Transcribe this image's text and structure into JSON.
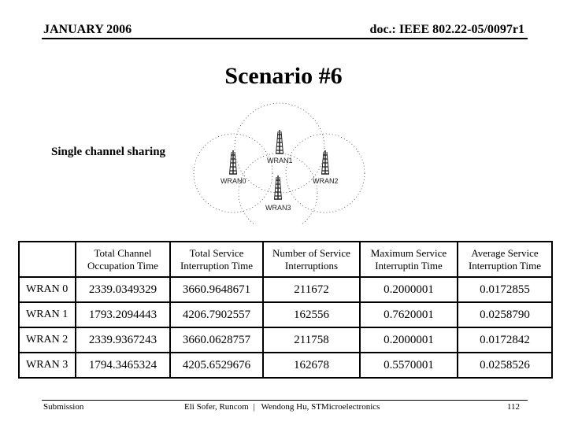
{
  "header": {
    "date": "JANUARY 2006",
    "doc_id": "doc.: IEEE 802.22-05/0097r1"
  },
  "title": "Scenario #6",
  "subtitle": "Single channel sharing",
  "diagram": {
    "stations": [
      {
        "label": "WRAN0",
        "icon": "tower-icon"
      },
      {
        "label": "WRAN1",
        "icon": "tower-icon"
      },
      {
        "label": "WRAN2",
        "icon": "tower-icon"
      },
      {
        "label": "WRAN3",
        "icon": "tower-icon"
      }
    ]
  },
  "table": {
    "headers": [
      "",
      "Total Channel Occupation Time",
      "Total Service Interruption Time",
      "Number of Service Interruptions",
      "Maximum Service Interruptin Time",
      "Average Service Interruption Time"
    ],
    "header_lines": [
      [
        "",
        ""
      ],
      [
        "Total Channel",
        "Occupation Time"
      ],
      [
        "Total Service",
        "Interruption Time"
      ],
      [
        "Number of Service",
        "Interruptions"
      ],
      [
        "Maximum Service",
        "Interruptin Time"
      ],
      [
        "Average Service",
        "Interruption Time"
      ]
    ],
    "rows": [
      [
        "WRAN 0",
        "2339.0349329",
        "3660.9648671",
        "211672",
        "0.2000001",
        "0.0172855"
      ],
      [
        "WRAN 1",
        "1793.2094443",
        "4206.7902557",
        "162556",
        "0.7620001",
        "0.0258790"
      ],
      [
        "WRAN 2",
        "2339.9367243",
        "3660.0628757",
        "211758",
        "0.2000001",
        "0.0172842"
      ],
      [
        "WRAN 3",
        "1794.3465324",
        "4205.6529676",
        "162678",
        "0.5570001",
        "0.0258526"
      ]
    ]
  },
  "footer": {
    "left": "Submission",
    "center": "Eli Sofer, Runcom  |   Wendong Hu, STMicroelectronics",
    "page": "112"
  }
}
